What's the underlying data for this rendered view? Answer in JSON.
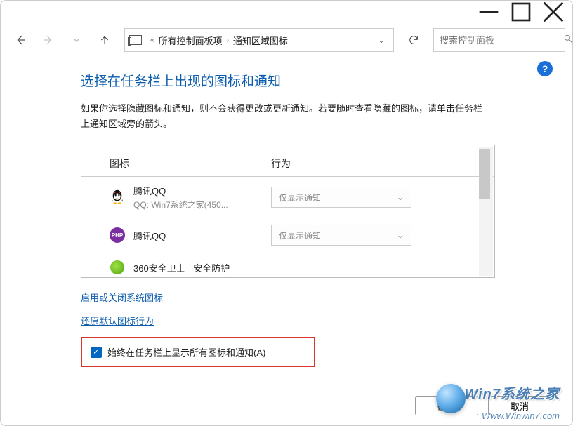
{
  "breadcrumb": {
    "parent": "所有控制面板项",
    "current": "通知区域图标"
  },
  "search": {
    "placeholder": "搜索控制面板"
  },
  "page": {
    "title": "选择在任务栏上出现的图标和通知",
    "desc": "如果你选择隐藏图标和通知，则不会获得更改或更新通知。若要随时查看隐藏的图标，请单击任务栏上通知区域旁的箭头。"
  },
  "columns": {
    "icon": "图标",
    "behavior": "行为"
  },
  "apps": [
    {
      "name": "腾讯QQ",
      "sub": "QQ: Win7系统之家(450...",
      "behavior": "仅显示通知",
      "iconType": "qq"
    },
    {
      "name": "腾讯QQ",
      "sub": "",
      "behavior": "仅显示通知",
      "iconType": "php",
      "iconText": "PHP"
    },
    {
      "name": "360安全卫士 - 安全防护",
      "sub": "",
      "behavior": "",
      "iconType": "360"
    }
  ],
  "links": {
    "toggleSystem": "启用或关闭系统图标",
    "restoreDefault": "还原默认图标行为"
  },
  "checkbox": {
    "label": "始终在任务栏上显示所有图标和通知(A)",
    "checked": true
  },
  "buttons": {
    "ok": "确定",
    "cancel": "取消"
  },
  "watermark": {
    "line1": "Win7系统之家",
    "line2": "Www.Winwin7.com"
  }
}
